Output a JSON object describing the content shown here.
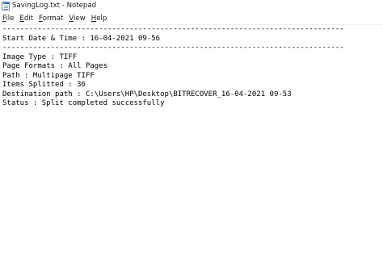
{
  "window": {
    "title": "SavingLog.txt - Notepad"
  },
  "menu": {
    "items": [
      {
        "key": "F",
        "rest": "ile"
      },
      {
        "key": "E",
        "rest": "dit"
      },
      {
        "key": "F",
        "rest": "ormat"
      },
      {
        "key": "V",
        "rest": "iew"
      },
      {
        "key": "H",
        "rest": "elp"
      }
    ]
  },
  "document": {
    "lines": [
      "------------------------------------------------------------------------------",
      "Start Date & Time : 16-04-2021 09-56",
      "------------------------------------------------------------------------------",
      "Image Type : TIFF",
      "Page Formats : All Pages",
      "Path : Multipage TIFF",
      "Items Splitted : 36",
      "Destination path : C:\\Users\\HP\\Desktop\\BITRECOVER_16-04-2021 09-53",
      "Status : Split completed successfully"
    ]
  }
}
